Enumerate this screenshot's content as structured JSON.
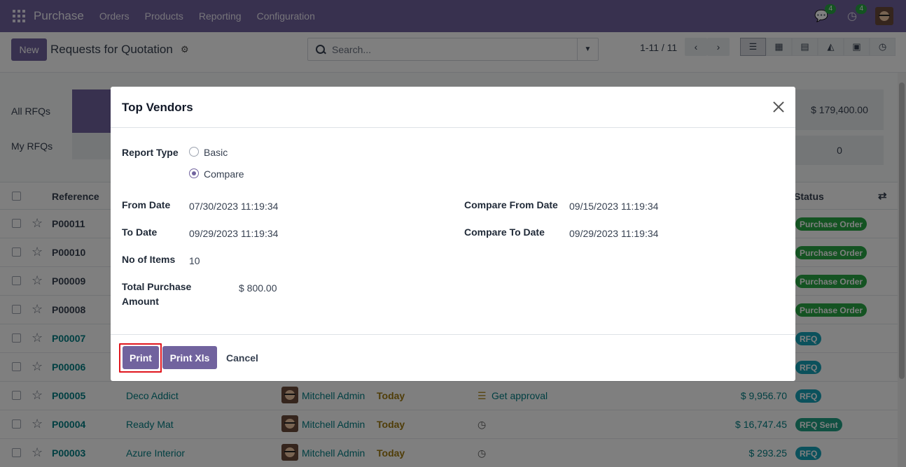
{
  "nav": {
    "app": "Purchase",
    "menu": [
      "Orders",
      "Products",
      "Reporting",
      "Configuration"
    ],
    "messages_count": "4",
    "activities_count": "4"
  },
  "control": {
    "new_label": "New",
    "title": "Requests for Quotation",
    "search_placeholder": "Search...",
    "pager": "1-11 / 11"
  },
  "dashboard": {
    "row1_label": "All RFQs",
    "row2_label": "My RFQs",
    "tile_label_partial": "To",
    "right_amount": "$ 179,400.00",
    "right_count": "0"
  },
  "list": {
    "headers": {
      "reference": "Reference",
      "status": "Status"
    },
    "rows": [
      {
        "ref": "P00011",
        "status": "Purchase Order"
      },
      {
        "ref": "P00010",
        "status": "Purchase Order"
      },
      {
        "ref": "P00009",
        "status": "Purchase Order"
      },
      {
        "ref": "P00008",
        "status": "Purchase Order"
      },
      {
        "ref": "P00007",
        "status": "RFQ"
      },
      {
        "ref": "P00006",
        "status": "RFQ"
      },
      {
        "ref": "P00005",
        "vendor": "Deco Addict",
        "buyer": "Mitchell Admin",
        "deadline": "Today",
        "activity": "Get approval",
        "amount": "$ 9,956.70",
        "status": "RFQ"
      },
      {
        "ref": "P00004",
        "vendor": "Ready Mat",
        "buyer": "Mitchell Admin",
        "deadline": "Today",
        "amount": "$ 16,747.45",
        "status": "RFQ Sent"
      },
      {
        "ref": "P00003",
        "vendor": "Azure Interior",
        "buyer": "Mitchell Admin",
        "deadline": "Today",
        "amount": "$ 293.25",
        "status": "RFQ"
      }
    ]
  },
  "modal": {
    "title": "Top Vendors",
    "report_type_label": "Report Type",
    "option_basic": "Basic",
    "option_compare": "Compare",
    "from_date_label": "From Date",
    "from_date": "07/30/2023 11:19:34",
    "to_date_label": "To Date",
    "to_date": "09/29/2023 11:19:34",
    "no_items_label": "No of Items",
    "no_items": "10",
    "total_label_1": "Total Purchase",
    "total_label_2": "Amount",
    "total_value": "$ 800.00",
    "cmp_from_label": "Compare From Date",
    "cmp_from": "09/15/2023 11:19:34",
    "cmp_to_label": "Compare To Date",
    "cmp_to": "09/29/2023 11:19:34",
    "print_label": "Print",
    "print_xls_label": "Print Xls",
    "cancel_label": "Cancel"
  }
}
